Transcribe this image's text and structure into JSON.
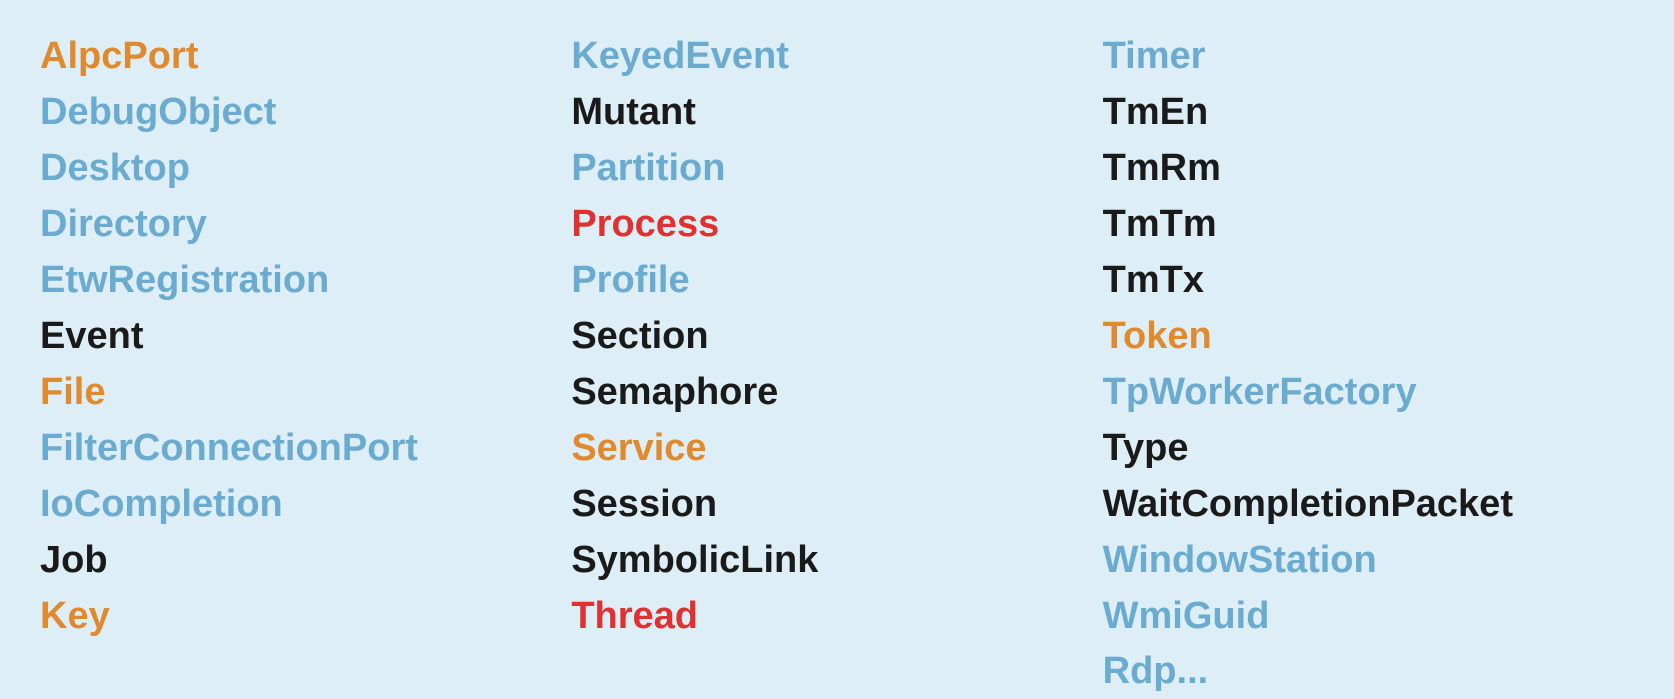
{
  "columns": [
    {
      "id": "col1",
      "items": [
        {
          "label": "AlpcPort",
          "color": "orange"
        },
        {
          "label": "DebugObject",
          "color": "blue"
        },
        {
          "label": "Desktop",
          "color": "blue"
        },
        {
          "label": "Directory",
          "color": "blue"
        },
        {
          "label": "EtwRegistration",
          "color": "blue"
        },
        {
          "label": "Event",
          "color": "black"
        },
        {
          "label": "File",
          "color": "orange"
        },
        {
          "label": "FilterConnectionPort",
          "color": "blue"
        },
        {
          "label": "IoCompletion",
          "color": "blue"
        },
        {
          "label": "Job",
          "color": "black"
        },
        {
          "label": "Key",
          "color": "orange"
        }
      ]
    },
    {
      "id": "col2",
      "items": [
        {
          "label": "KeyedEvent",
          "color": "blue"
        },
        {
          "label": "Mutant",
          "color": "black"
        },
        {
          "label": "Partition",
          "color": "blue"
        },
        {
          "label": "Process",
          "color": "red"
        },
        {
          "label": "Profile",
          "color": "blue"
        },
        {
          "label": "Section",
          "color": "black"
        },
        {
          "label": "Semaphore",
          "color": "black"
        },
        {
          "label": "Service",
          "color": "orange"
        },
        {
          "label": "Session",
          "color": "black"
        },
        {
          "label": "SymbolicLink",
          "color": "black"
        },
        {
          "label": "Thread",
          "color": "red"
        }
      ]
    },
    {
      "id": "col3",
      "items": [
        {
          "label": "Timer",
          "color": "blue"
        },
        {
          "label": "TmEn",
          "color": "black"
        },
        {
          "label": "TmRm",
          "color": "black"
        },
        {
          "label": "TmTm",
          "color": "black"
        },
        {
          "label": "TmTx",
          "color": "black"
        },
        {
          "label": "Token",
          "color": "orange"
        },
        {
          "label": "TpWorkerFactory",
          "color": "blue"
        },
        {
          "label": "Type",
          "color": "black"
        },
        {
          "label": "WaitCompletionPacket",
          "color": "black"
        },
        {
          "label": "WindowStation",
          "color": "blue"
        },
        {
          "label": "WmiGuid",
          "color": "blue"
        },
        {
          "label": "Rdp...",
          "color": "blue"
        }
      ]
    }
  ]
}
